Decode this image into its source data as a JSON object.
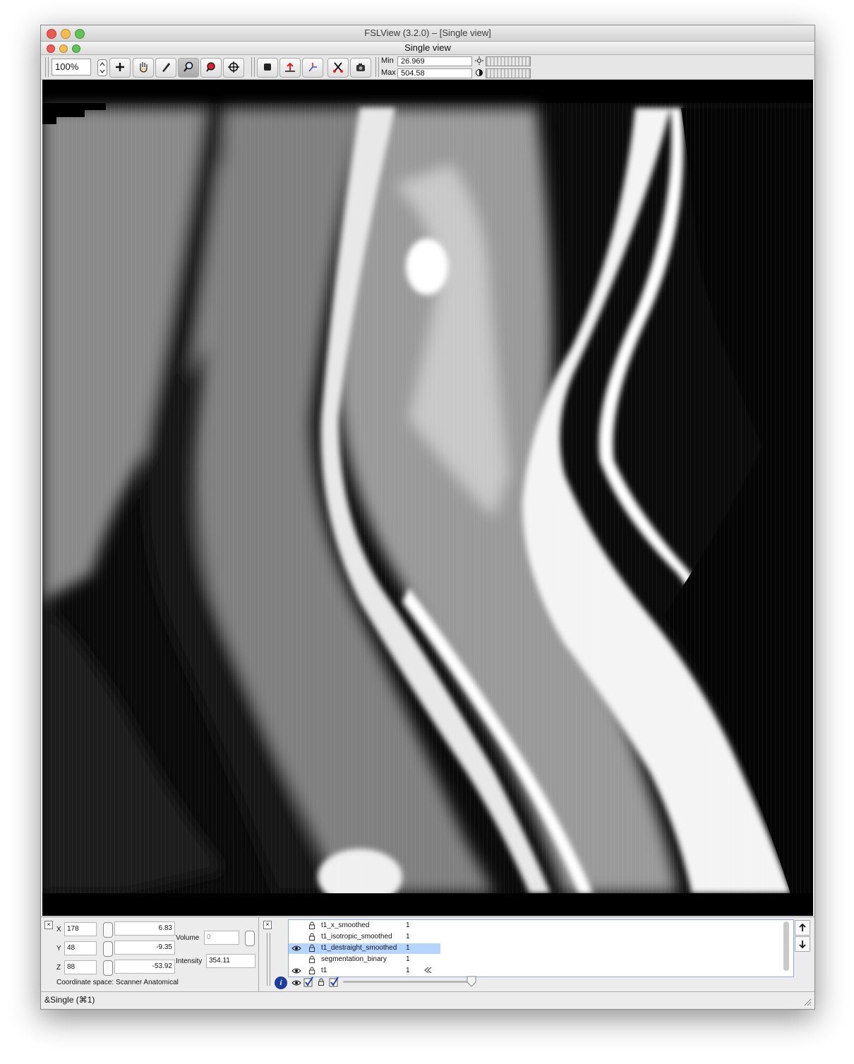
{
  "window": {
    "title": "FSLView (3.2.0) – [Single view]",
    "subtitle": "Single view"
  },
  "colors": {
    "close": "#ee5a52",
    "minimize": "#f5bd4f",
    "zoom": "#5fc454",
    "selection": "#b5d4ff"
  },
  "toolbar": {
    "zoom_value": "100%",
    "tools": [
      "plus-icon",
      "hand-icon",
      "pencil-icon",
      "magnifier-icon",
      "zoom-region-icon",
      "crosshair-icon",
      "cube-icon",
      "arrow-up-icon",
      "axes-icon",
      "scissors-icon",
      "camera-icon"
    ],
    "min_label": "Min",
    "min_value": "26.969",
    "max_label": "Max",
    "max_value": "504.58"
  },
  "coords": {
    "x_label": "X",
    "x_voxel": "178",
    "x_world": "6.83",
    "y_label": "Y",
    "y_voxel": "48",
    "y_world": "-9.35",
    "z_label": "Z",
    "z_voxel": "88",
    "z_world": "-53.92",
    "volume_label": "Volume",
    "volume_value": "0",
    "intensity_label": "Intensity",
    "intensity_value": "354.11",
    "coordinate_space": "Coordinate space: Scanner Anatomical"
  },
  "layers": [
    {
      "name": "t1_x_smoothed",
      "value": "1",
      "visible": false,
      "selected": false
    },
    {
      "name": "t1_isotropic_smoothed",
      "value": "1",
      "visible": false,
      "selected": false
    },
    {
      "name": "t1_destraight_smoothed",
      "value": "1",
      "visible": true,
      "selected": true
    },
    {
      "name": "segmentation_binary",
      "value": "1",
      "visible": false,
      "selected": false
    },
    {
      "name": "t1",
      "value": "1",
      "visible": true,
      "selected": false
    }
  ],
  "status": {
    "text": "&Single (⌘1)"
  }
}
